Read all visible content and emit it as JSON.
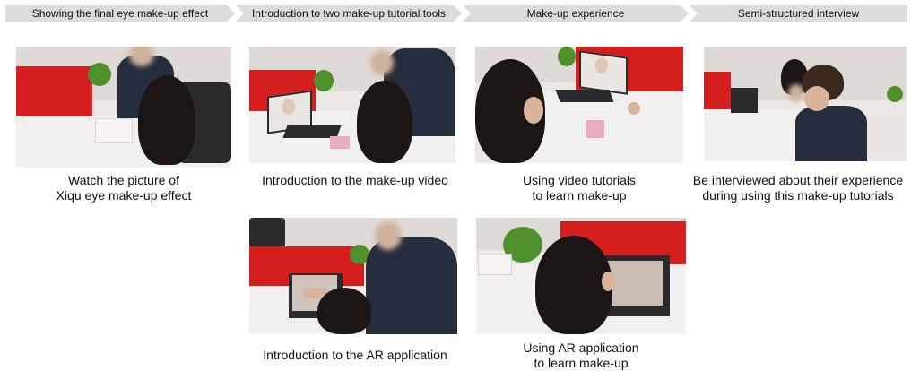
{
  "stages": [
    {
      "label": "Showing the final eye make-up effect"
    },
    {
      "label": "Introduction to two make-up tutorial tools"
    },
    {
      "label": "Make-up experience"
    },
    {
      "label": "Semi-structured interview"
    }
  ],
  "panels": [
    {
      "caption": [
        "Watch the picture of",
        "Xiqu eye make-up effect"
      ]
    },
    {
      "caption": [
        "Introduction to the make-up video"
      ]
    },
    {
      "caption": [
        "Using video tutorials",
        "to learn make-up"
      ]
    },
    {
      "caption": [
        "Be interviewed about their experience",
        "during using this make-up tutorials"
      ]
    },
    {
      "caption": [
        "Introduction to the AR application"
      ]
    },
    {
      "caption": [
        "Using AR application",
        "to learn make-up"
      ]
    }
  ]
}
